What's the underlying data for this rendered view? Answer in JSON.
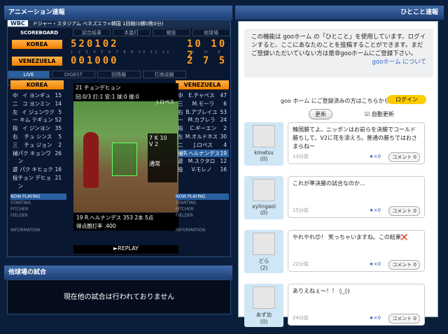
{
  "titles": {
    "left": "アニメーション速報",
    "right": "ひとこと速報",
    "other": "他球場の試合"
  },
  "scoreboard": {
    "badge": "WBC",
    "game": "ドジャー・スタジアム ベネズエラ×韓国 1回戦(0勝0敗0分)",
    "label": "SCOREBOARD",
    "tabs": [
      "試合結果",
      "本塁打",
      "継投",
      "他球場"
    ],
    "teams": [
      {
        "name": "KOREA",
        "innings": "520102",
        "rhe": "10 10 2"
      },
      {
        "name": "VENEZUELA",
        "innings": "001000",
        "rhe": "2 7 5"
      }
    ],
    "inning_nums": "1 2 3 4 5 6 7 8 9 10 11 12",
    "rhe_labels": "R H E"
  },
  "live_tabs": [
    "LIVE",
    "DIGEST",
    "回情報",
    "打席成績",
    "投手成績"
  ],
  "lineup_left": {
    "team": "KOREA",
    "rows": [
      [
        "中",
        "イ ヨンギュ",
        "15"
      ],
      [
        "二",
        "コ ヨンミン",
        "14"
      ],
      [
        "左",
        "イ ジュンウク",
        "5"
      ],
      [
        "一",
        "キム テギュン",
        "52"
      ],
      [
        "指",
        "イ ジンヨン",
        "35"
      ],
      [
        "右",
        "チュ シンス",
        "5"
      ],
      [
        "三",
        "チュ ジョン",
        "2"
      ],
      [
        "捕",
        "パク キョンワン",
        "26"
      ],
      [
        "遊",
        "パク キヒョク",
        "16"
      ],
      [
        "投",
        "チョン デヒョン",
        "21"
      ]
    ]
  },
  "lineup_right": {
    "team": "VENEZUELA",
    "rows": [
      [
        "中",
        "E.チャベス",
        "47"
      ],
      [
        "三",
        "M.モーラ",
        "6"
      ],
      [
        "右",
        "B.アブレイユ",
        "53"
      ],
      [
        "一",
        "M.カブレラ",
        "24"
      ],
      [
        "指",
        "C.ギーエン",
        "2"
      ],
      [
        "左",
        "M.オルドネス",
        "30"
      ],
      [
        "二",
        "J.ロペス",
        "4"
      ],
      [
        "捕",
        "R.ヘルナンデス",
        "19"
      ],
      [
        "遊",
        "M.スクタロ",
        "12"
      ],
      [
        "投",
        "V.モレノ",
        "16"
      ]
    ]
  },
  "field": {
    "pitcher_line": "21 チョンデヒョン",
    "stats": "回:0/3 打:1 安:1 球:0 振:0",
    "runner": "J.ロペス",
    "count_b": "7",
    "count_k": "10",
    "count_v": "2",
    "mode": "通常",
    "batter_line": "19 R.ヘルナンデス 353 2本 5点",
    "batter_stat": "得点圏打率 .400",
    "replay": "►REPLAY"
  },
  "now_playing": [
    "NOW PLAYING",
    "STARTING",
    "PITCHER",
    "FIELDER",
    "INFORMATION"
  ],
  "notice": {
    "text": "この機能は gooホーム の「ひとこと」を使用しています。ログインすると、ここにあなたのことを投稿することができます。まだご登録いただいていない方は是非gooホームにご登録下さい。",
    "link": "gooホーム について"
  },
  "login_prompt": "goo ホーム にご登録済みの方はこちらから",
  "login_btn": "ログイン",
  "refresh_btn": "更新",
  "auto_label": "自動更新",
  "comments": [
    {
      "user": "kmatsu",
      "count": "(0)",
      "text": "韓国勝てよ。ニッポンはお前らを決勝でコールド勝ちして、V2に花を添えろ。普通の勝ちではおさまらねー",
      "time": "13分前",
      "likes": "★×0",
      "btn": "コメント 0"
    },
    {
      "user": "xylingaol",
      "count": "(0)",
      "text": "これが準決勝の試合なのか…",
      "time": "15分前",
      "likes": "★×0",
      "btn": "コメント 0"
    },
    {
      "user": "どら",
      "count": "(2)",
      "text": "やれやれ😊！ 笑っちゃいますね。この結果❌",
      "time": "22分前",
      "likes": "★×0",
      "btn": "コメント 0"
    },
    {
      "user": "あず坊",
      "count": "(0)",
      "text": "ありえねぇ～！！ ◊_◊)",
      "time": "24分前",
      "likes": "★×0",
      "btn": "コメント 0"
    }
  ],
  "other_games": "現在他の試合は行われておりません"
}
